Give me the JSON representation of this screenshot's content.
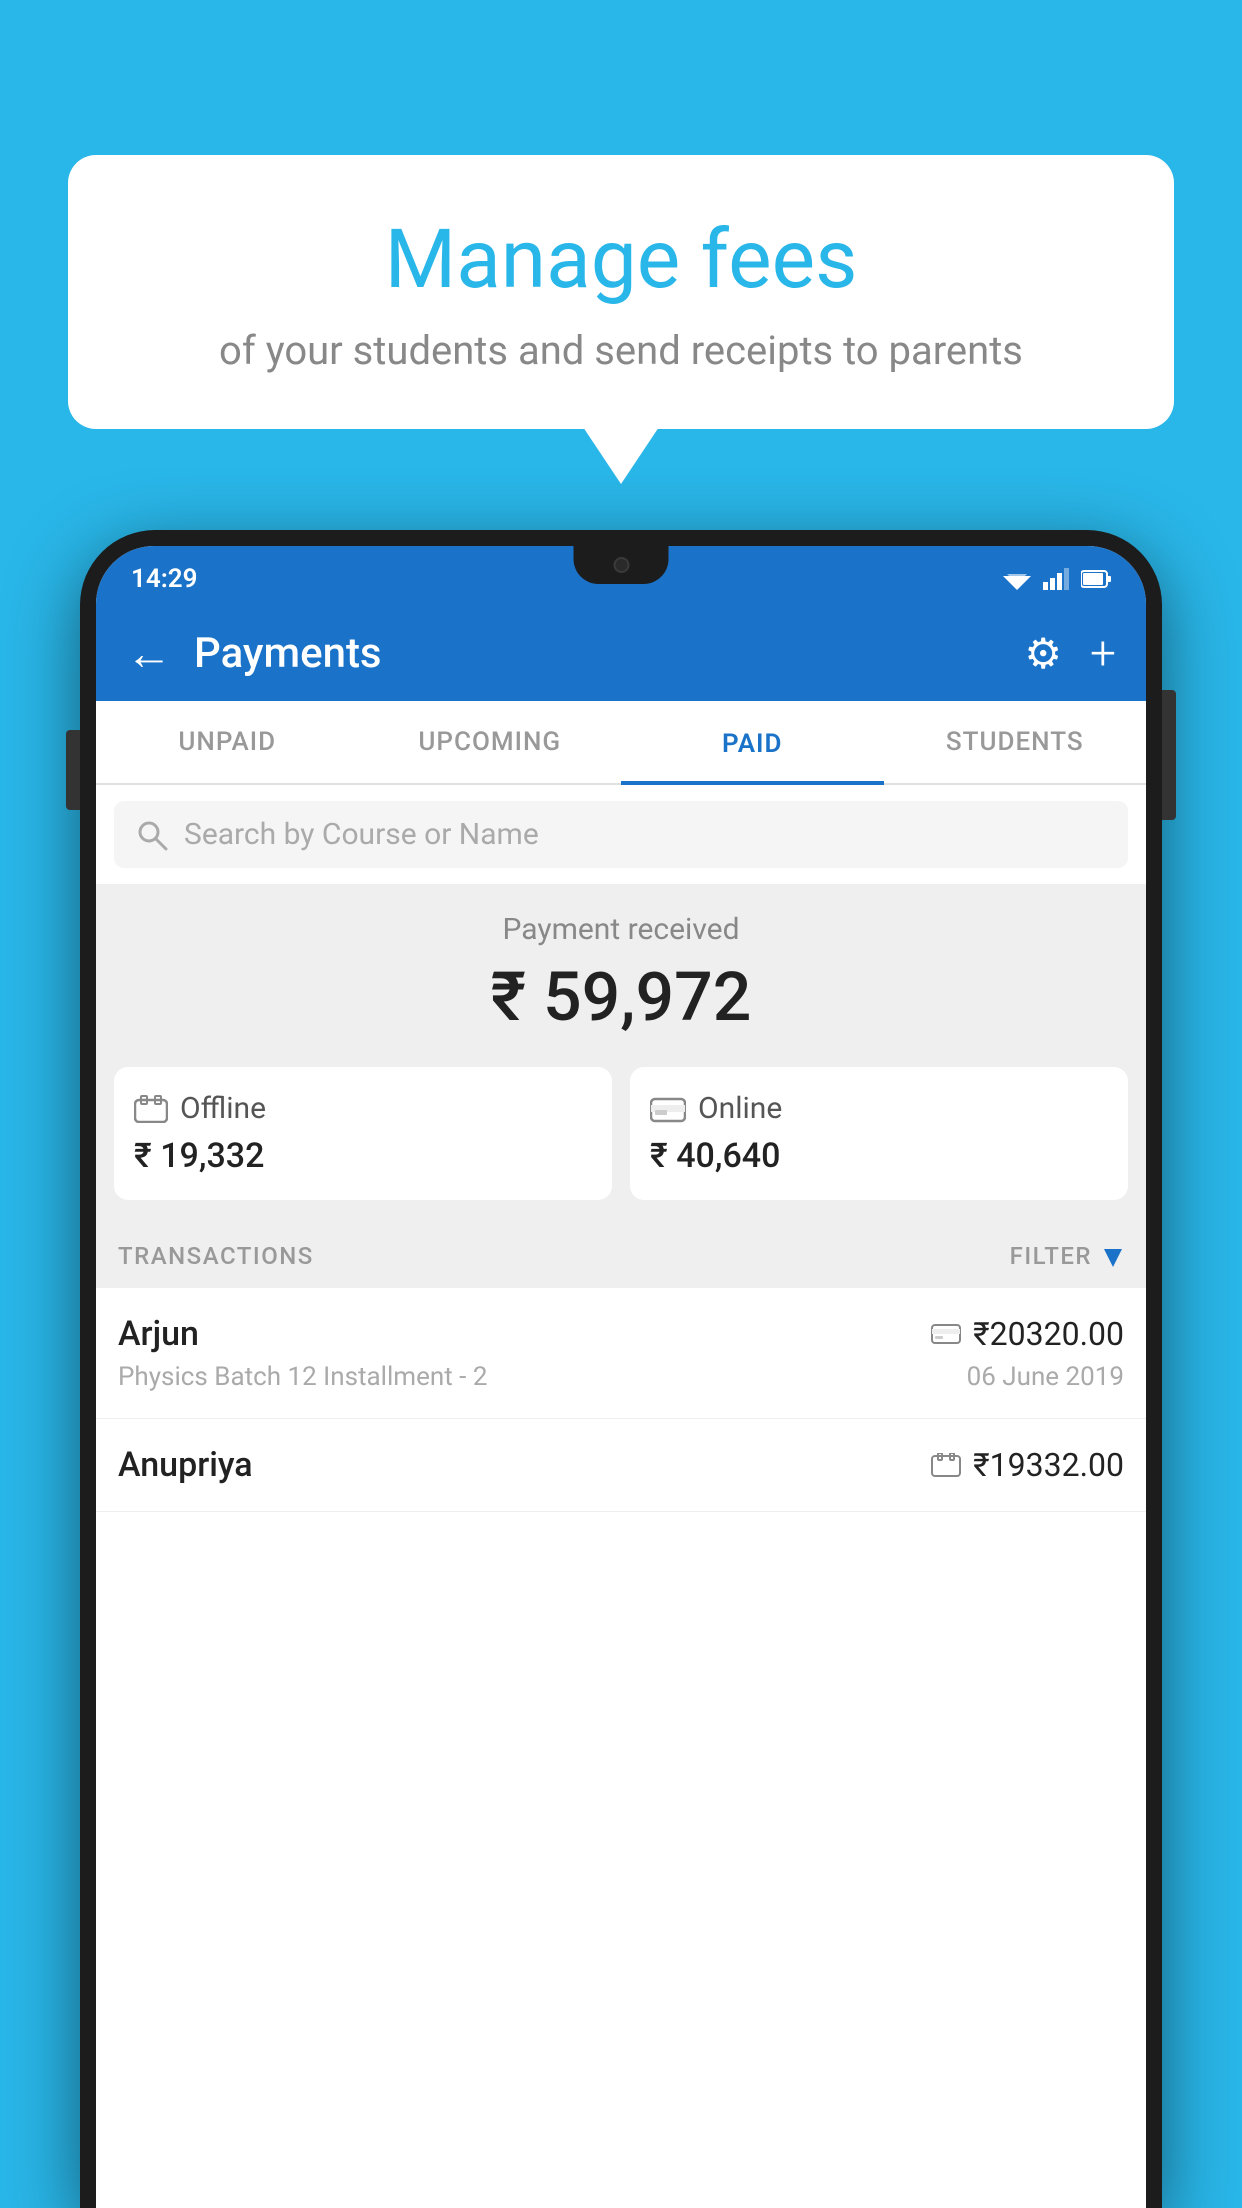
{
  "background_color": "#29b6e8",
  "bubble": {
    "title": "Manage fees",
    "subtitle": "of your students and send receipts to parents"
  },
  "status_bar": {
    "time": "14:29",
    "wifi": "▼",
    "signal": "▲",
    "battery": "▮"
  },
  "header": {
    "title": "Payments",
    "back_label": "←",
    "gear_label": "⚙",
    "plus_label": "+"
  },
  "tabs": [
    {
      "label": "UNPAID",
      "active": false
    },
    {
      "label": "UPCOMING",
      "active": false
    },
    {
      "label": "PAID",
      "active": true
    },
    {
      "label": "STUDENTS",
      "active": false
    }
  ],
  "search": {
    "placeholder": "Search by Course or Name"
  },
  "payment_summary": {
    "label": "Payment received",
    "amount": "₹ 59,972"
  },
  "cards": [
    {
      "icon": "offline",
      "label": "Offline",
      "amount": "₹ 19,332"
    },
    {
      "icon": "online",
      "label": "Online",
      "amount": "₹ 40,640"
    }
  ],
  "transactions_label": "TRANSACTIONS",
  "filter_label": "FILTER",
  "transactions": [
    {
      "name": "Arjun",
      "detail": "Physics Batch 12 Installment - 2",
      "amount": "₹20320.00",
      "date": "06 June 2019",
      "payment_type": "card"
    },
    {
      "name": "Anupriya",
      "detail": "",
      "amount": "₹19332.00",
      "date": "",
      "payment_type": "offline"
    }
  ]
}
